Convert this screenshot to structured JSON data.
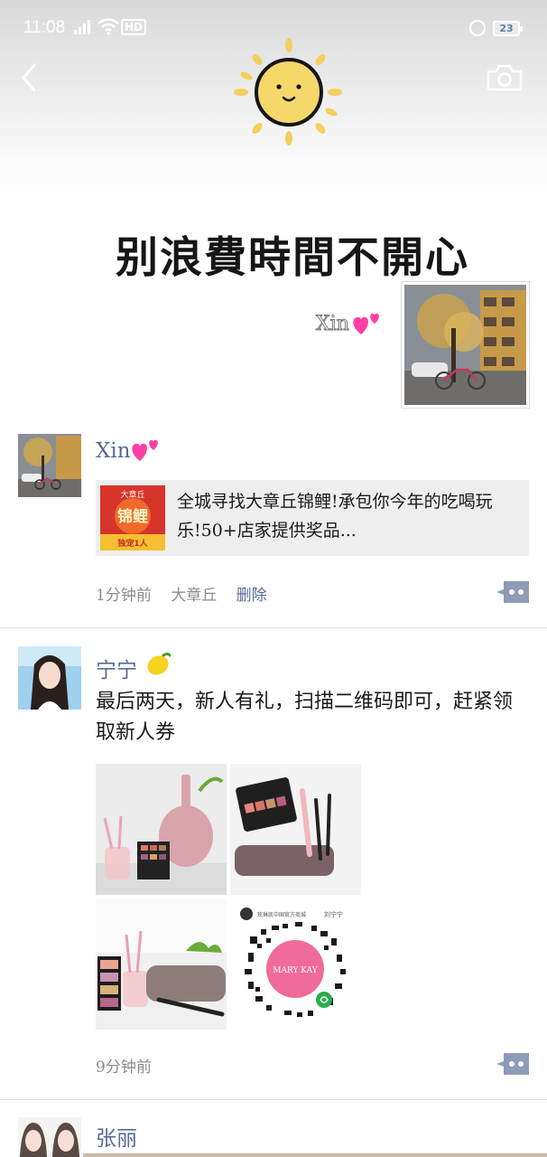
{
  "status_bar": {
    "time": "11:08",
    "network": "4G",
    "hd": "HD",
    "battery": "23"
  },
  "header": {
    "back_icon": "chevron-left-icon",
    "camera_icon": "camera-icon",
    "cover_slogan": "别浪費時間不開心",
    "my_name": "Xin"
  },
  "posts": [
    {
      "author": "Xin",
      "link_card": {
        "badge_top": "大章丘",
        "badge_main": "锦鲤",
        "badge_bottom": "独宠1人",
        "text": "全城寻找大章丘锦鲤!承包你今年的吃喝玩乐!50+店家提供奖品..."
      },
      "time": "1分钟前",
      "location": "大章丘",
      "delete_label": "删除"
    },
    {
      "author": "宁宁",
      "text": "最后两天，新人有礼，扫描二维码即可，赶紧领取新人券",
      "qr_brand": "MARY KAY",
      "qr_header_left": "玫琳凯中国官方商城",
      "qr_header_right": "刘宁宁",
      "time": "9分钟前"
    },
    {
      "author": "张丽"
    }
  ],
  "colors": {
    "link_blue": "#576b95",
    "meta_gray": "#8b8b8b",
    "card_bg": "#eeeeee"
  }
}
